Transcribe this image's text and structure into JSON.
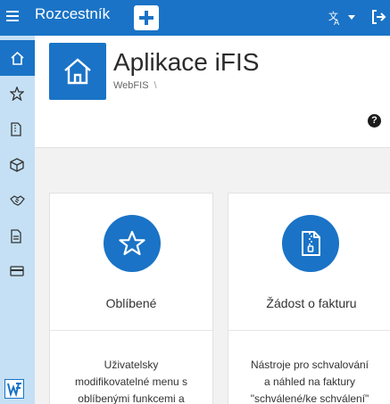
{
  "topbar": {
    "title": "Rozcestník",
    "icons": [
      "hamburger-menu-icon",
      "plus-icon",
      "translate-icon",
      "logout-icon"
    ]
  },
  "sidebar": {
    "items": [
      {
        "icon": "home-icon",
        "active": true
      },
      {
        "icon": "star-icon"
      },
      {
        "icon": "document-zipper-icon"
      },
      {
        "icon": "box-icon"
      },
      {
        "icon": "handshake-icon"
      },
      {
        "icon": "document-icon"
      },
      {
        "icon": "credit-card-icon"
      }
    ],
    "logo": "ifis-logo-icon"
  },
  "header": {
    "title": "Aplikace iFIS",
    "breadcrumb": "WebFIS",
    "breadcrumb_sep": "\\",
    "help": "?"
  },
  "tiles": [
    {
      "icon": "star-icon",
      "title": "Oblíbené",
      "desc1": "Uživatelsky",
      "desc2": "modifikovatelné menu s",
      "desc3": "oblíbenými funkcemi a"
    },
    {
      "icon": "zip-document-icon",
      "title": "Žádost o fakturu",
      "desc1": "Nástroje pro schvalování",
      "desc2": "a náhled na faktury",
      "desc3": "\"schválené/ke schválení\""
    }
  ],
  "colors": {
    "primary": "#1a73c6",
    "sidebar_bg": "#c5e0f4",
    "page_bg": "#f2f2f2"
  }
}
